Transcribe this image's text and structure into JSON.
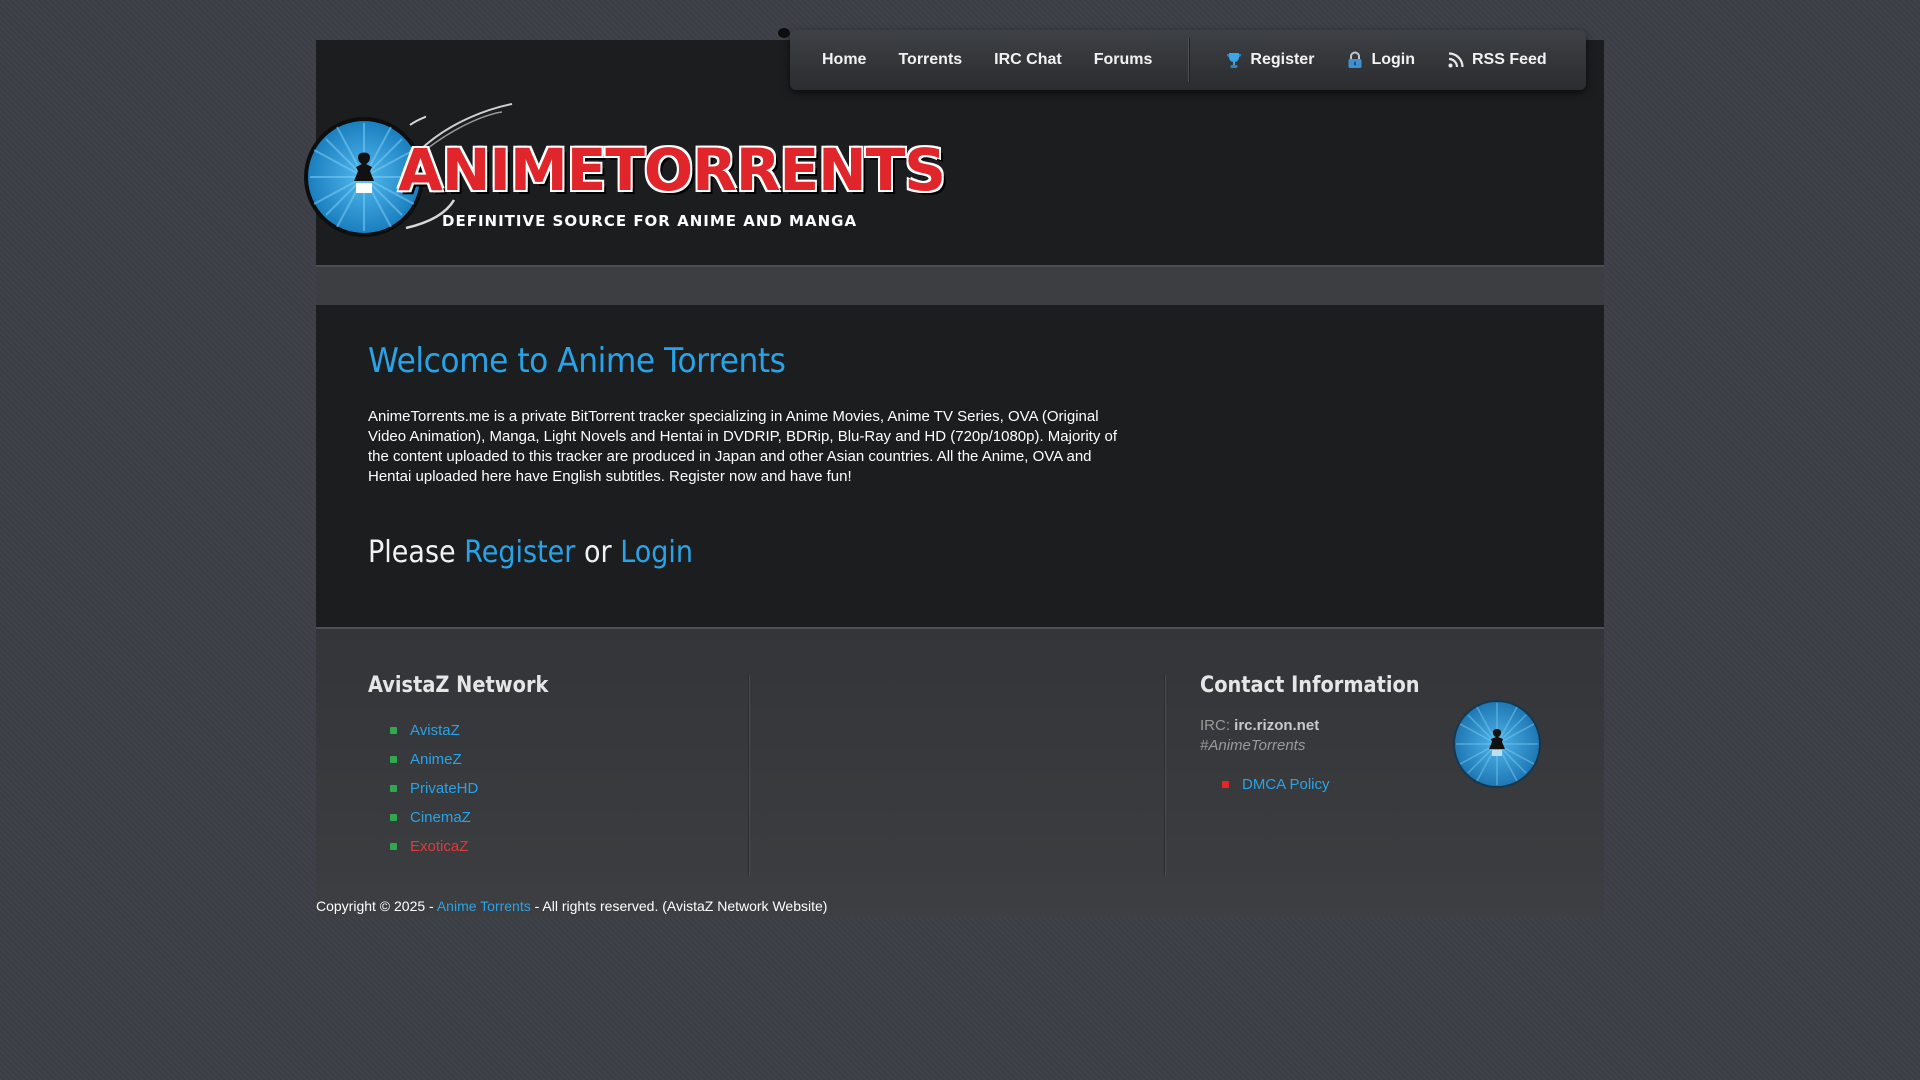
{
  "nav": {
    "left_items": [
      {
        "label": "Home"
      },
      {
        "label": "Torrents"
      },
      {
        "label": "IRC Chat"
      },
      {
        "label": "Forums"
      }
    ],
    "register_label": "Register",
    "login_label": "Login",
    "rss_label": "RSS Feed"
  },
  "logo": {
    "title": "ANIMETORRENTS",
    "subtitle": "DEFINITIVE SOURCE FOR ANIME AND MANGA"
  },
  "main": {
    "welcome_title": "Welcome to Anime Torrents",
    "intro_text": "AnimeTorrents.me is a private BitTorrent tracker specializing in Anime Movies, Anime TV Series, OVA (Original Video Animation), Manga, Light Novels and Hentai in DVDRIP, BDRip, Blu-Ray and HD (720p/1080p). Majority of the content uploaded to this tracker are produced in Japan and other Asian countries. All the Anime, OVA and Hentai uploaded here have English subtitles. Register now and have fun!",
    "please_prefix": "Please",
    "please_register": "Register",
    "please_or": "or",
    "please_login": "Login"
  },
  "footer": {
    "network_title": "AvistaZ Network",
    "network_links": [
      {
        "label": "AvistaZ",
        "color": "#29a3e8"
      },
      {
        "label": "AnimeZ",
        "color": "#29a3e8"
      },
      {
        "label": "PrivateHD",
        "color": "#29a3e8"
      },
      {
        "label": "CinemaZ",
        "color": "#29a3e8"
      },
      {
        "label": "ExoticaZ",
        "color": "#e03a3a"
      }
    ],
    "network_bullet_color": "#2fa84f",
    "contact_title": "Contact Information",
    "irc_label": "IRC:",
    "irc_server": "irc.rizon.net",
    "irc_channel": "#AnimeTorrents",
    "dmca_label": "DMCA Policy",
    "dmca_bullet_color": "#e02828"
  },
  "copyright": {
    "prefix": "Copyright © 2025 -",
    "site_link": "Anime Torrents",
    "suffix": "- All rights reserved. (AvistaZ Network Website)"
  },
  "colors": {
    "accent_blue": "#29a3e8",
    "logo_red": "#e0262a",
    "background": "#3c4046",
    "panel_dark": "#1c1d1f"
  },
  "icons": {
    "register": "trophy-icon",
    "login": "lock-icon",
    "rss": "rss-icon"
  }
}
